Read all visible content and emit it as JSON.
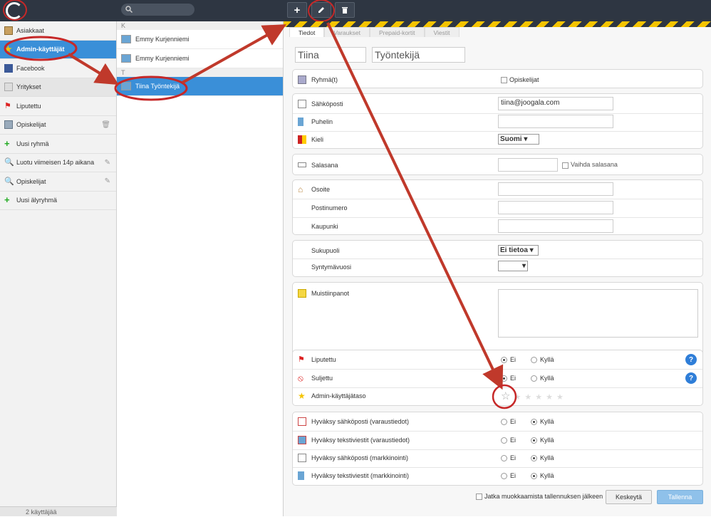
{
  "sidebar": {
    "items": [
      {
        "label": "Asiakkaat",
        "icon": "book-icon"
      },
      {
        "label": "Admin-käyttäjät",
        "icon": "star-icon"
      },
      {
        "label": "Facebook",
        "icon": "facebook-icon"
      },
      {
        "label": "Yritykset",
        "icon": "company-icon"
      },
      {
        "label": "Liputettu",
        "icon": "flag-icon"
      },
      {
        "label": "Opiskelijat",
        "icon": "group-icon"
      },
      {
        "label": "Uusi ryhmä",
        "icon": "plus-icon"
      },
      {
        "label": "Luotu viimeisen 14p aikana",
        "icon": "search-icon"
      },
      {
        "label": "Opiskelijat",
        "icon": "search-icon"
      },
      {
        "label": "Uusi älyryhmä",
        "icon": "plus-icon"
      }
    ],
    "footer": "2 käyttäjää"
  },
  "list": {
    "letter_k": "K",
    "letter_t": "T",
    "items": [
      {
        "name": "Emmy Kurjenniemi"
      },
      {
        "name": "Emmy Kurjenniemi"
      },
      {
        "name": "Tiina Työntekijä"
      }
    ]
  },
  "toolbar": {
    "add": "+",
    "delete": "🗑"
  },
  "tabs": [
    "Tiedot",
    "Varaukset",
    "Prepaid-kortit",
    "Viestit"
  ],
  "form": {
    "first_name": "Tiina",
    "last_name": "Työntekijä",
    "groups_label": "Ryhmä(t)",
    "group_option": "Opiskelijat",
    "email_label": "Sähköposti",
    "email_value": "tiina@joogala.com",
    "phone_label": "Puhelin",
    "language_label": "Kieli",
    "language_value": "Suomi",
    "password_label": "Salasana",
    "change_password": "Vaihda salasana",
    "address_label": "Osoite",
    "postcode_label": "Postinumero",
    "city_label": "Kaupunki",
    "gender_label": "Sukupuoli",
    "gender_value": "Ei tietoa",
    "birthyear_label": "Syntymävuosi",
    "notes_label": "Muistiinpanot",
    "flagged_label": "Liputettu",
    "closed_label": "Suljettu",
    "admin_level_label": "Admin-käyttäjätaso",
    "admin_level_value": 0,
    "admin_level_max": 6,
    "consent_email_booking": "Hyväksy sähköposti (varaustiedot)",
    "consent_sms_booking": "Hyväksy tekstiviestit (varaustiedot)",
    "consent_email_marketing": "Hyväksy sähköposti (markkinointi)",
    "consent_sms_marketing": "Hyväksy tekstiviestit (markkinointi)",
    "no": "Ei",
    "yes": "Kyllä",
    "help": "?",
    "continue_editing": "Jatka muokkaamista tallennuksen jälkeen",
    "cancel": "Keskeytä",
    "save": "Tallenna"
  },
  "colors": {
    "accent": "#3a8fd8",
    "annotation": "#c62828",
    "topbar": "#2e3642"
  }
}
